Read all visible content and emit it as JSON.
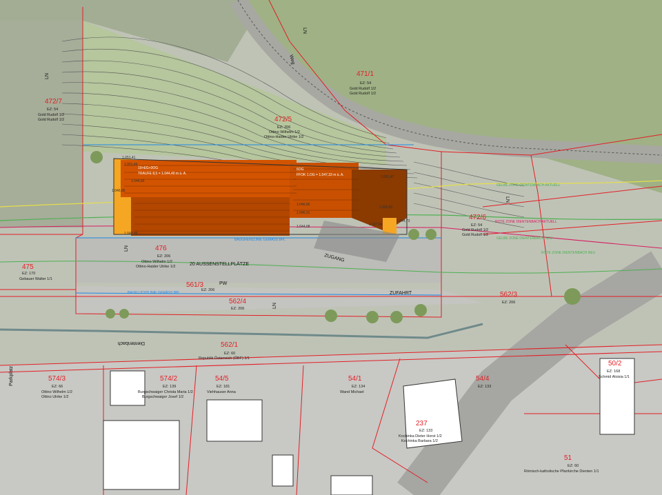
{
  "parcels": [
    {
      "id": "p471_1",
      "number": "471/1",
      "ez": "EZ: 54",
      "owners": [
        "Gold Rudolf 1/2",
        "Gold Rudolf 1/2"
      ]
    },
    {
      "id": "p472_7",
      "number": "472/7",
      "ez": "EZ: 54",
      "owners": [
        "Gold Rudolf 1/2",
        "Gold Rudolf 1/2"
      ]
    },
    {
      "id": "p472_5",
      "number": "472/5",
      "ez": "EZ: 206",
      "owners": [
        "Ottino Wilhelm 1/2",
        "Ottino-Haider Ulrike 1/2"
      ]
    },
    {
      "id": "p472_6",
      "number": "472/6",
      "ez": "EZ: 54",
      "owners": [
        "Gold Rudolf 1/2",
        "Gold Rudolf 1/2"
      ]
    },
    {
      "id": "p476",
      "number": "476",
      "ez": "EZ: 206",
      "owners": [
        "Ottino Wilhelm 1/2",
        "Ottino-Haider Ulrike 1/2"
      ]
    },
    {
      "id": "p475",
      "number": "475",
      "ez": "EZ: 170",
      "owners": [
        "Gebauer Walter 1/1"
      ]
    },
    {
      "id": "p561_3",
      "number": "561/3",
      "ez": "EZ: 206",
      "owners": []
    },
    {
      "id": "p562_4",
      "number": "562/4",
      "ez": "EZ: 206",
      "owners": []
    },
    {
      "id": "p562_3",
      "number": "562/3",
      "ez": "EZ: 206",
      "owners": []
    },
    {
      "id": "p562_1",
      "number": "562/1",
      "ez": "EZ: 60",
      "owners": [
        "Republik Österreich (ÖBF) 1/1"
      ]
    },
    {
      "id": "p574_3",
      "number": "574/3",
      "ez": "EZ: 66",
      "owners": [
        "Ottino Wilhelm 1/2",
        "Ottino Ulrike 1/2"
      ]
    },
    {
      "id": "p574_2",
      "number": "574/2",
      "ez": "EZ: 139",
      "owners": [
        "Burgschwaiger Christa Maria 1/2",
        "Burgschwaiger Josef 1/2"
      ]
    },
    {
      "id": "p54_5",
      "number": "54/5",
      "ez": "EZ: 181",
      "owners": [
        "Viehhauser Anna"
      ]
    },
    {
      "id": "p54_1",
      "number": "54/1",
      "ez": "EZ: 134",
      "owners": [
        "Wand Michael"
      ]
    },
    {
      "id": "p54_4",
      "number": "54/4",
      "ez": "EZ: 133",
      "owners": []
    },
    {
      "id": "p237",
      "number": "237",
      "ez": "EZ: 133",
      "owners": [
        "Kochinka Dieter Horst 1/2",
        "Kochinka Barbara 1/2"
      ]
    },
    {
      "id": "p50_2",
      "number": "50/2",
      "ez": "EZ: 168",
      "owners": [
        "Schmid Aloisia 1/1"
      ]
    },
    {
      "id": "p51",
      "number": "51",
      "ez": "EZ: 60",
      "owners": [
        "Römisch-katholische Pfarrkirche Dienten 1/1"
      ]
    }
  ],
  "labels": {
    "zugang": "ZUGANG",
    "zufahrt": "ZUFAHRT",
    "parking": "20 AUSSENSTELLPLÄTZE",
    "dientenbach": "Dientenbach",
    "weg": "Weg",
    "parkplatz": "Parkplatz",
    "ln": "LN",
    "pw": "PW"
  },
  "zones": {
    "gelb": "GELBE ZONE DIENTENBACH AKTUELL",
    "rot_aktuell": "ROTE ZONE DIENTENBACH AKTUELL",
    "gelb_neu": "GELBE ZONE DIENTENBACH NEU",
    "rot_neu": "ROTE ZONE DIENTENBACH NEU",
    "baugrenze": "BAUGRENZLINIE GEMÄSS BPL",
    "baufluchtlinie": "BAUFLUCHTLINIE GEMÄSS BPL"
  },
  "building": {
    "left_caption": "10+EG+3OG",
    "left_height": "TRAUFE 8,5 = 1.044,40 m ü. A.",
    "right_caption": "6OG",
    "right_height": "FFOK 1.OG = 1.047,33 m ü. A.",
    "elevations": [
      "1.051,41",
      "1.051,49",
      "1.044,90",
      "1.046,95",
      "1.043,99",
      "1.044,08",
      "1.047,84",
      "1.050,82",
      "1.051,47",
      "1.046,96",
      "1.044,73",
      "1.046,31"
    ]
  },
  "colors": {
    "parcel_line": "#e31e24",
    "roof": "#d35400",
    "roof_dark": "#a04000",
    "annex": "#f5a623",
    "meadow": "#a9c47f",
    "asphalt": "#b4b4b0",
    "zone_green": "#4caf50",
    "zone_blue": "#1e88e5",
    "zone_yellow": "#e5e04a",
    "zone_red": "#d81b60"
  }
}
